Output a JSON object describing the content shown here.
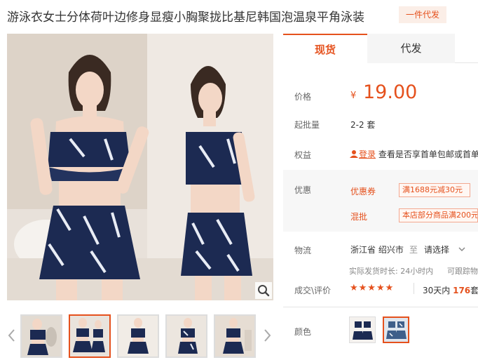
{
  "product": {
    "title": "游泳衣女士分体荷叶边修身显瘦小胸聚拢比基尼韩国泡温泉平角泳装",
    "badge": "一件代发"
  },
  "tabs": [
    {
      "label": "现货",
      "active": true
    },
    {
      "label": "代发",
      "active": false
    }
  ],
  "price": {
    "label": "价格",
    "currency": "¥",
    "value": "19.00"
  },
  "moq": {
    "label": "起批量",
    "value": "2-2 套"
  },
  "rights": {
    "label": "权益",
    "login_link": "登录",
    "text": "查看是否享首单包邮或首单"
  },
  "promotions": {
    "label": "优惠",
    "items": [
      {
        "tag": "优惠券",
        "text": "满1688元减30元"
      },
      {
        "tag": "混批",
        "text": "本店部分商品满200元"
      }
    ]
  },
  "logistics": {
    "label": "物流",
    "from": "浙江省 绍兴市",
    "to_word": "至",
    "select_placeholder": "请选择",
    "ship_time": "实际发货时长: 24小时内",
    "track": "可跟踪物"
  },
  "reviews": {
    "label": "成交\\评价",
    "stars": "★★★★★",
    "rating": 5,
    "sales_prefix": "30天内",
    "sales_count": "176",
    "sales_suffix": "套"
  },
  "color": {
    "label": "颜色",
    "options_count": 2,
    "selected_index": 1
  },
  "thumbnails": {
    "count": 5,
    "active_index": 1
  },
  "colors": {
    "accent": "#e5511d",
    "swimsuit_navy": "#1c2a52",
    "skin": "#f3d7c6"
  },
  "icons": {
    "zoom": "magnifier-icon",
    "prev": "chevron-left-icon",
    "next": "chevron-right-icon",
    "login": "user-icon",
    "dropdown": "chevron-down-icon"
  }
}
